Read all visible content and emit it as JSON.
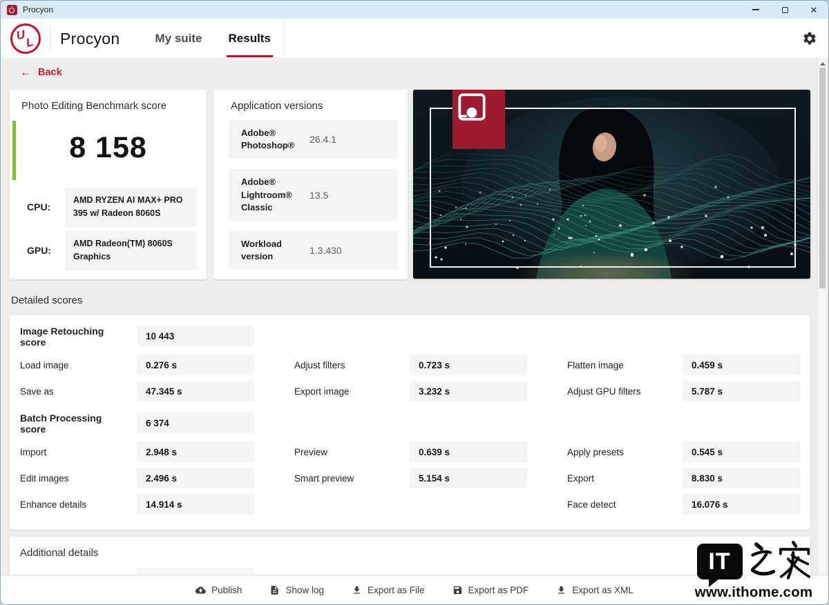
{
  "window": {
    "title": "Procyon"
  },
  "nav": {
    "logo": "UL",
    "brand": "Procyon",
    "tabs": [
      {
        "label": "My suite",
        "active": false
      },
      {
        "label": "Results",
        "active": true
      }
    ]
  },
  "back": {
    "label": "Back"
  },
  "score_card": {
    "title": "Photo Editing Benchmark score",
    "score": "8 158",
    "specs": [
      {
        "label": "CPU:",
        "value": "AMD RYZEN AI MAX+ PRO 395 w/ Radeon 8060S"
      },
      {
        "label": "GPU:",
        "value": "AMD Radeon(TM) 8060S Graphics"
      }
    ]
  },
  "versions_card": {
    "title": "Application versions",
    "rows": [
      {
        "label": "Adobe® Photoshop®",
        "value": "26.4.1"
      },
      {
        "label": "Adobe® Lightroom® Classic",
        "value": "13.5"
      },
      {
        "label": "Workload version",
        "value": "1.3.430"
      }
    ]
  },
  "detailed_scores": {
    "heading": "Detailed scores",
    "rows": [
      {
        "section": true,
        "cells": [
          {
            "label": "Image Retouching score",
            "value": "10 443"
          },
          null,
          null
        ]
      },
      {
        "section": false,
        "cells": [
          {
            "label": "Load image",
            "value": "0.276 s"
          },
          {
            "label": "Adjust filters",
            "value": "0.723 s"
          },
          {
            "label": "Flatten image",
            "value": "0.459 s"
          }
        ]
      },
      {
        "section": false,
        "cells": [
          {
            "label": "Save as",
            "value": "47.345 s"
          },
          {
            "label": "Export image",
            "value": "3.232 s"
          },
          {
            "label": "Adjust GPU filters",
            "value": "5.787 s"
          }
        ]
      },
      {
        "section": true,
        "cells": [
          {
            "label": "Batch Processing score",
            "value": "6 374"
          },
          null,
          null
        ]
      },
      {
        "section": false,
        "cells": [
          {
            "label": "Import",
            "value": "2.948 s"
          },
          {
            "label": "Preview",
            "value": "0.639 s"
          },
          {
            "label": "Apply presets",
            "value": "0.545 s"
          }
        ]
      },
      {
        "section": false,
        "cells": [
          {
            "label": "Edit images",
            "value": "2.496 s"
          },
          {
            "label": "Smart preview",
            "value": "5.154 s"
          },
          {
            "label": "Export",
            "value": "8.830 s"
          }
        ]
      },
      {
        "section": false,
        "cells": [
          {
            "label": "Enhance details",
            "value": "14.914 s"
          },
          null,
          {
            "label": "Face detect",
            "value": "16.076 s"
          }
        ]
      }
    ]
  },
  "additional_details": {
    "heading": "Additional details"
  },
  "footer": {
    "buttons": [
      {
        "name": "publish-button",
        "label": "Publish",
        "icon": "cloud-upload-icon"
      },
      {
        "name": "show-log-button",
        "label": "Show log",
        "icon": "document-icon"
      },
      {
        "name": "export-file-button",
        "label": "Export as File",
        "icon": "download-icon"
      },
      {
        "name": "export-pdf-button",
        "label": "Export as PDF",
        "icon": "save-icon"
      },
      {
        "name": "export-xml-button",
        "label": "Export as XML",
        "icon": "download-icon"
      }
    ]
  },
  "watermark": {
    "logo_text": "IT",
    "logo_suffix": "之家",
    "url": "www.ithome.com"
  },
  "icons": {
    "titlebar": [
      "app-logo-icon",
      "minimize-icon",
      "maximize-icon",
      "close-icon"
    ],
    "nav": [
      "ul-logo-icon",
      "gear-icon"
    ],
    "content": [
      "back-arrow-icon",
      "procyon-photo-editing-badge-icon"
    ],
    "scrollbar": [
      "scroll-up-icon"
    ]
  },
  "colors": {
    "accent_red": "#c8102e",
    "score_green": "#83bd3f",
    "badge_red": "#9e1b32",
    "titlebar": "#d8ebf4"
  }
}
